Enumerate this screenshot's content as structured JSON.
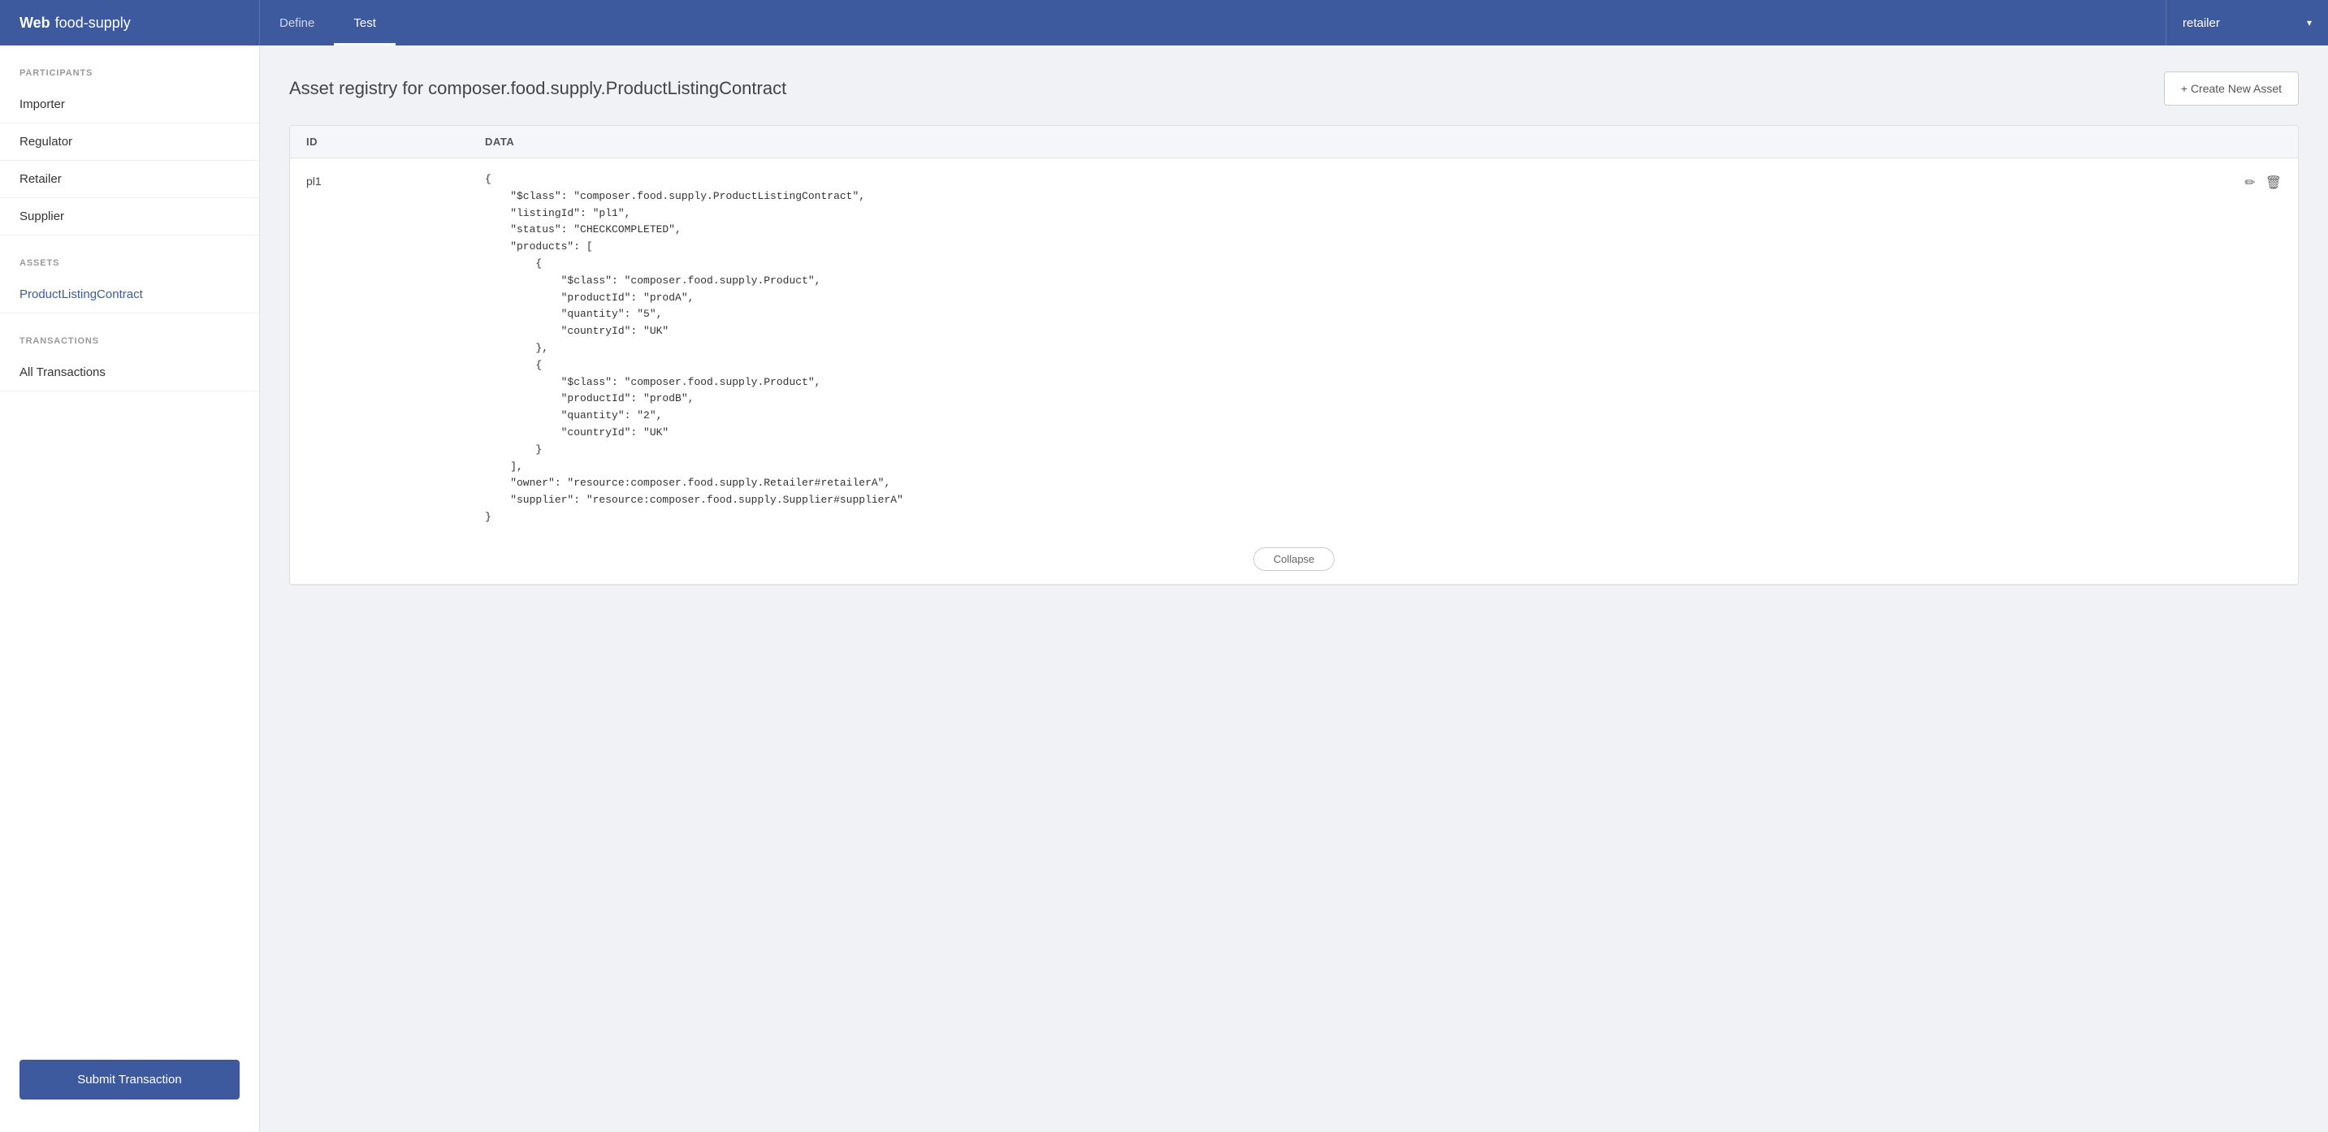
{
  "topbar": {
    "brand_web": "Web",
    "brand_name": "food-supply",
    "nav_items": [
      {
        "label": "Define",
        "active": false
      },
      {
        "label": "Test",
        "active": true
      }
    ],
    "user": "retailer",
    "dropdown_arrow": "▾"
  },
  "sidebar": {
    "sections": [
      {
        "label": "PARTICIPANTS",
        "items": [
          {
            "label": "Importer",
            "active": false
          },
          {
            "label": "Regulator",
            "active": false
          },
          {
            "label": "Retailer",
            "active": false
          },
          {
            "label": "Supplier",
            "active": false
          }
        ]
      },
      {
        "label": "ASSETS",
        "items": [
          {
            "label": "ProductListingContract",
            "active": true
          }
        ]
      },
      {
        "label": "TRANSACTIONS",
        "items": [
          {
            "label": "All Transactions",
            "active": false
          }
        ]
      }
    ],
    "submit_label": "Submit Transaction"
  },
  "main": {
    "title": "Asset registry for composer.food.supply.ProductListingContract",
    "create_button": "+ Create New Asset",
    "table": {
      "columns": [
        "ID",
        "Data"
      ],
      "rows": [
        {
          "id": "pl1",
          "data": "{\n    \"$class\": \"composer.food.supply.ProductListingContract\",\n    \"listingId\": \"pl1\",\n    \"status\": \"CHECKCOMPLETED\",\n    \"products\": [\n        {\n            \"$class\": \"composer.food.supply.Product\",\n            \"productId\": \"prodA\",\n            \"quantity\": \"5\",\n            \"countryId\": \"UK\"\n        },\n        {\n            \"$class\": \"composer.food.supply.Product\",\n            \"productId\": \"prodB\",\n            \"quantity\": \"2\",\n            \"countryId\": \"UK\"\n        }\n    ],\n    \"owner\": \"resource:composer.food.supply.Retailer#retailerA\",\n    \"supplier\": \"resource:composer.food.supply.Supplier#supplierA\"\n}",
          "collapse_label": "Collapse"
        }
      ]
    }
  },
  "icons": {
    "edit": "✏",
    "delete": "🗑"
  }
}
